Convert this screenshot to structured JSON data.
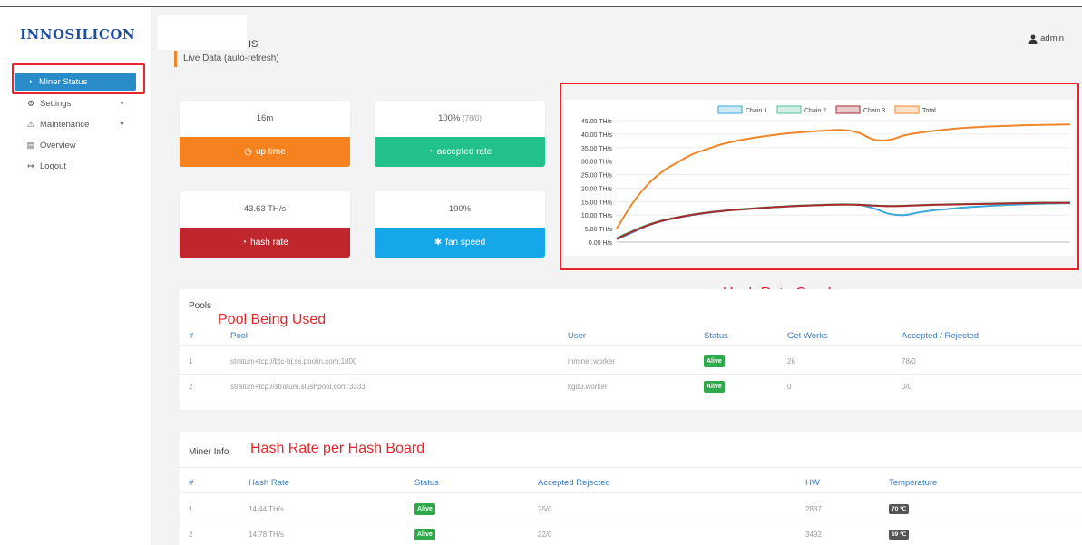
{
  "brand": {
    "logo": "INNOSILICON"
  },
  "sidebar": {
    "items": [
      {
        "label": "Miner Status",
        "icon": "dashboard-icon"
      },
      {
        "label": "Settings",
        "icon": "gears-icon"
      },
      {
        "label": "Maintenance",
        "icon": "plug-icon"
      },
      {
        "label": "Overview",
        "icon": "server-icon"
      },
      {
        "label": "Logout",
        "icon": "sign-out-icon"
      }
    ]
  },
  "header": {
    "title": "IS",
    "subtitle": "Live Data (auto-refresh)",
    "user": "admin"
  },
  "cards": {
    "uptime": {
      "value": "16m",
      "label": "up time",
      "color": "#f5821f"
    },
    "accepted": {
      "value": "100%",
      "detail": "(78/0)",
      "label": "accepted rate",
      "color": "#22c08a"
    },
    "hashrate": {
      "value": "43.63 TH/s",
      "label": "hash rate",
      "color": "#c0272d"
    },
    "fan": {
      "value": "100%",
      "label": "fan speed",
      "color": "#16a7ea"
    }
  },
  "chart_data": {
    "type": "line",
    "legend": [
      "Chain 1",
      "Chain 2",
      "Chain 3",
      "Total"
    ],
    "legend_position": "top-center",
    "y_ticks": [
      "45.00 TH/s",
      "40.00 TH/s",
      "35.00 TH/s",
      "30.00 TH/s",
      "25.00 TH/s",
      "20.00 TH/s",
      "15.00 TH/s",
      "10.00 TH/s",
      "5.00 TH/s",
      "0.00 H/s"
    ],
    "ylim": [
      0,
      45
    ],
    "xlim": [
      0,
      30
    ],
    "colors": {
      "Chain 1": "#3aa9d9",
      "Chain 2": "#52c196",
      "Chain 3": "#a92a2a",
      "Total": "#f0862a"
    },
    "series": [
      {
        "name": "Chain 1",
        "x": [
          0,
          1,
          2,
          3,
          4,
          5,
          6,
          7,
          8,
          9,
          10,
          11,
          12,
          13,
          14,
          15,
          16,
          17,
          18,
          19,
          20,
          21,
          22,
          23,
          24,
          25,
          26,
          27,
          28,
          29,
          30
        ],
        "values": [
          1,
          3.5,
          6,
          7.8,
          9,
          10,
          10.8,
          11.5,
          12,
          12.4,
          12.8,
          13.1,
          13.4,
          13.6,
          13.8,
          13.9,
          13.8,
          12.5,
          10.5,
          10,
          11,
          11.8,
          12.3,
          12.8,
          13.2,
          13.5,
          13.8,
          14,
          14.2,
          14.3,
          14.4
        ]
      },
      {
        "name": "Chain 2",
        "x": [
          0,
          1,
          2,
          3,
          4,
          5,
          6,
          7,
          8,
          9,
          10,
          11,
          12,
          13,
          14,
          15,
          16,
          17,
          18,
          19,
          20,
          21,
          22,
          23,
          24,
          25,
          26,
          27,
          28,
          29,
          30
        ],
        "values": [
          1.5,
          4,
          6.3,
          8,
          9.2,
          10.2,
          11,
          11.6,
          12.1,
          12.5,
          12.9,
          13.2,
          13.5,
          13.7,
          13.9,
          14,
          13.9,
          13.6,
          13.4,
          13.5,
          13.7,
          13.9,
          14,
          14.1,
          14.2,
          14.3,
          14.4,
          14.5,
          14.6,
          14.6,
          14.6
        ]
      },
      {
        "name": "Chain 3",
        "x": [
          0,
          1,
          2,
          3,
          4,
          5,
          6,
          7,
          8,
          9,
          10,
          11,
          12,
          13,
          14,
          15,
          16,
          17,
          18,
          19,
          20,
          21,
          22,
          23,
          24,
          25,
          26,
          27,
          28,
          29,
          30
        ],
        "values": [
          1.2,
          3.8,
          6.1,
          7.9,
          9.1,
          10.1,
          10.9,
          11.5,
          12,
          12.4,
          12.8,
          13.1,
          13.4,
          13.6,
          13.8,
          13.9,
          13.8,
          13.5,
          13.3,
          13.4,
          13.6,
          13.8,
          13.9,
          14,
          14.1,
          14.2,
          14.3,
          14.4,
          14.5,
          14.5,
          14.5
        ]
      },
      {
        "name": "Total",
        "x": [
          0,
          1,
          2,
          3,
          4,
          5,
          6,
          7,
          8,
          9,
          10,
          11,
          12,
          13,
          14,
          15,
          16,
          17,
          18,
          19,
          20,
          21,
          22,
          23,
          24,
          25,
          26,
          27,
          28,
          29,
          30
        ],
        "values": [
          5,
          14,
          21,
          26,
          29.5,
          32.5,
          34.5,
          36.3,
          37.6,
          38.6,
          39.4,
          40.1,
          40.6,
          41,
          41.4,
          41.5,
          40.5,
          38,
          37.8,
          39.5,
          40.5,
          41.2,
          41.8,
          42.3,
          42.6,
          42.9,
          43.1,
          43.3,
          43.4,
          43.5,
          43.6
        ]
      }
    ]
  },
  "pools": {
    "title": "Pools",
    "columns": [
      "#",
      "Pool",
      "User",
      "Status",
      "Get Works",
      "Accepted / Rejected"
    ],
    "rows": [
      {
        "index": "1",
        "pool": "stratum+tcp://btc-bj.ss.poolin.com:1800",
        "user": "inminer.worker",
        "status": "Alive",
        "get_works": "26",
        "accepted": "78/0"
      },
      {
        "index": "2",
        "pool": "stratum+tcp://stratum.slushpool.com:3333",
        "user": "kgdu.worker",
        "status": "Alive",
        "get_works": "0",
        "accepted": "0/0"
      }
    ]
  },
  "miner_info": {
    "title": "Miner Info",
    "columns": [
      "#",
      "Hash Rate",
      "Status",
      "Accepted Rejected",
      "HW",
      "Temperature"
    ],
    "rows": [
      {
        "index": "1",
        "hash_rate": "14.44 TH/s",
        "status": "Alive",
        "accepted": "25/0",
        "hw": "2837",
        "temp": "70 ℃"
      },
      {
        "index": "2",
        "hash_rate": "14.78 TH/s",
        "status": "Alive",
        "accepted": "22/0",
        "hw": "3492",
        "temp": "69 ℃"
      }
    ]
  },
  "annotations": {
    "graph": "Hash Rate Graph",
    "pool": "Pool Being Used",
    "board": "Hash Rate per Hash Board"
  }
}
